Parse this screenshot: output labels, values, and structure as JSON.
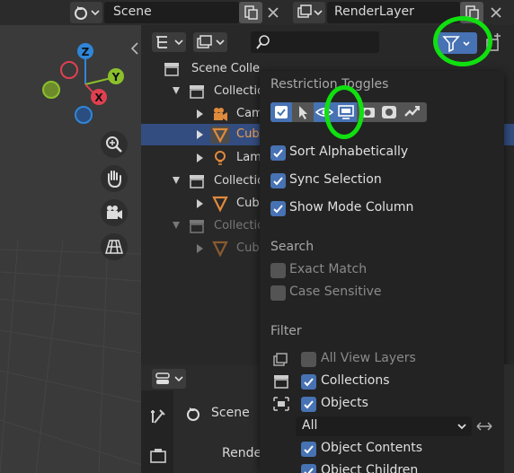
{
  "header": {
    "scene_name": "Scene",
    "view_layer_name": "RenderLayer"
  },
  "outliner": {
    "rows": [
      {
        "label": "Scene Colle"
      },
      {
        "label": "Collection"
      },
      {
        "label": "Cam"
      },
      {
        "label": "Cub"
      },
      {
        "label": "Lam"
      },
      {
        "label": "Collection"
      },
      {
        "label": "Cub"
      },
      {
        "label": "Collection"
      },
      {
        "label": "Cub"
      }
    ]
  },
  "popover": {
    "restriction_title": "Restriction Toggles",
    "sort_alphabetically": "Sort Alphabetically",
    "sync_selection": "Sync Selection",
    "show_mode_column": "Show Mode Column",
    "search_title": "Search",
    "exact_match": "Exact Match",
    "case_sensitive": "Case Sensitive",
    "filter_title": "Filter",
    "all_view_layers": "All View Layers",
    "collections": "Collections",
    "objects": "Objects",
    "object_filter_value": "All",
    "object_contents": "Object Contents",
    "object_children": "Object Children"
  },
  "properties": {
    "scene_label": "Scene",
    "render_label": "Rende"
  },
  "gizmo": {
    "x": "X",
    "y": "Y",
    "z": "Z"
  },
  "colors": {
    "accent_blue": "#4772b3",
    "selected_row": "#334d80",
    "annotation_green": "#10e010",
    "axis_x": "#e04050",
    "axis_y": "#8bc02b",
    "axis_z": "#2f86d9"
  }
}
